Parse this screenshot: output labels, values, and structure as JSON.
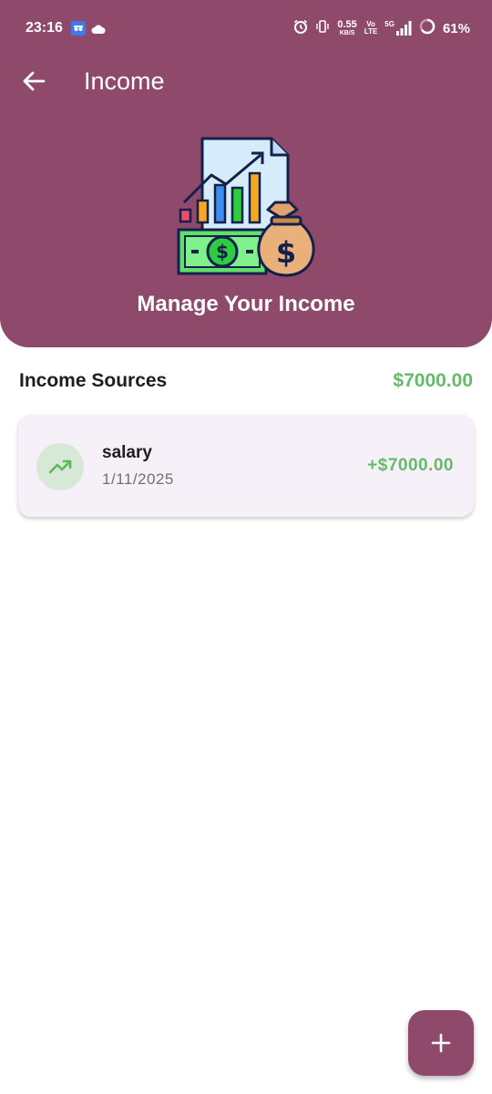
{
  "status_bar": {
    "time": "23:16",
    "net_speed_value": "0.55",
    "net_speed_unit": "KB/S",
    "volte_top": "Vo",
    "volte_bottom": "LTE",
    "network": "5G",
    "battery": "61%"
  },
  "appbar": {
    "title": "Income",
    "back_icon": "arrow-left-icon"
  },
  "hero": {
    "title": "Manage Your Income",
    "illustration": "income-chart-money-illustration"
  },
  "income_sources": {
    "title": "Income Sources",
    "total": "$7000.00",
    "items": [
      {
        "name": "salary",
        "date": "1/11/2025",
        "amount": "+$7000.00",
        "icon": "trending-up-icon"
      }
    ]
  },
  "fab": {
    "icon": "plus-icon"
  },
  "colors": {
    "primary": "#8f4a6b",
    "positive": "#66bb6a",
    "card_bg": "#f6f0f8",
    "icon_bg": "#d8e8d6"
  }
}
